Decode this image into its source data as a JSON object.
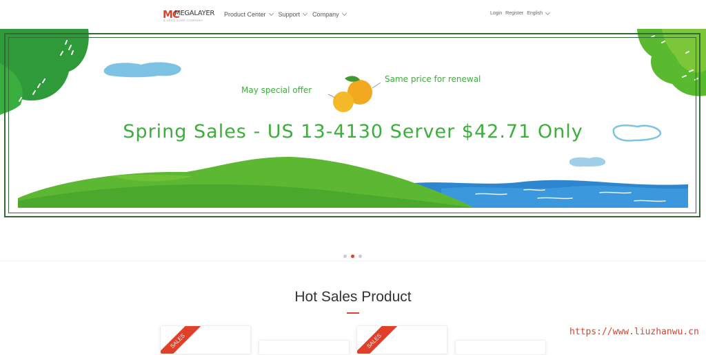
{
  "header": {
    "logo_mark": "MC",
    "logo_name": "MEGALAYER",
    "logo_tagline": "A VPSS CORP COMPANY",
    "nav": [
      {
        "label": "Product Center"
      },
      {
        "label": "Support"
      },
      {
        "label": "Company"
      }
    ],
    "login": "Login",
    "register": "Register",
    "language": "English"
  },
  "banner": {
    "note_left": "May special offer",
    "note_right": "Same price for renewal",
    "headline": "Spring Sales - US 13-4130 Server $42.71 Only",
    "slides_total": 3,
    "active_slide": 2
  },
  "section": {
    "title": "Hot Sales Product",
    "ribbon_label": "SALES"
  },
  "watermark": "https://www.liuzhanwu.cn",
  "colors": {
    "accent": "#e0402a",
    "banner_green": "#3cae3b",
    "frame": "#2f6b33"
  }
}
